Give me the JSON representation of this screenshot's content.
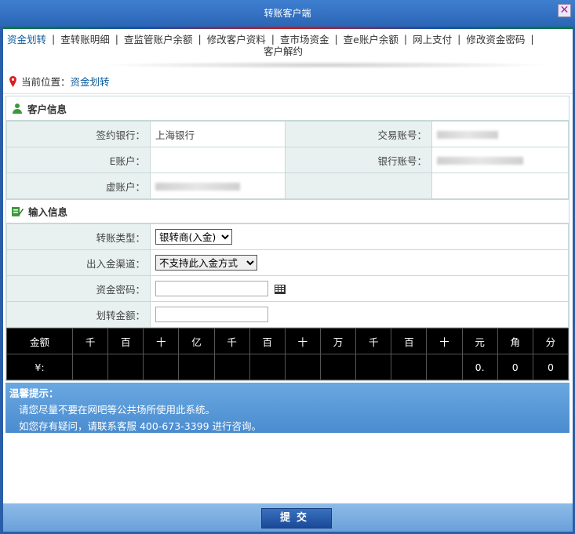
{
  "window": {
    "title": "转账客户端",
    "close": "✕"
  },
  "menu": {
    "items": [
      "资金划转",
      "查转账明细",
      "查监管账户余额",
      "修改客户资料",
      "查市场资金",
      "查e账户余额",
      "网上支付",
      "修改资金密码",
      "客户解约"
    ]
  },
  "location": {
    "label": "当前位置：",
    "link": "资金划转"
  },
  "customer_info": {
    "title": "客户信息",
    "bank_label": "签约银行：",
    "bank_value": "上海银行",
    "trade_acct_label": "交易账号：",
    "e_acct_label": "E账户：",
    "bank_acct_label": "银行账号：",
    "virtual_acct_label": "虚账户："
  },
  "input_info": {
    "title": "输入信息",
    "transfer_type_label": "转账类型：",
    "transfer_type_value": "银转商(入金)",
    "channel_label": "出入金渠道：",
    "channel_value": "不支持此入金方式",
    "password_label": "资金密码：",
    "amount_label": "划转金额："
  },
  "amount_grid": {
    "header": [
      "金额",
      "千",
      "百",
      "十",
      "亿",
      "千",
      "百",
      "十",
      "万",
      "千",
      "百",
      "十",
      "元",
      "角",
      "分"
    ],
    "row": [
      "¥:",
      "",
      "",
      "",
      "",
      "",
      "",
      "",
      "",
      "",
      "",
      "",
      "0.",
      "0",
      "0"
    ]
  },
  "tips": {
    "title": "温馨提示：",
    "line1": "请您尽量不要在网吧等公共场所使用此系统。",
    "line2": "如您存有疑问，请联系客服  400-673-3399 进行咨询。"
  },
  "submit_label": "提交",
  "colors": {
    "title_bar": "#2b65b5",
    "grid_bg": "#000000",
    "tip_bg": "#5a9ad8"
  }
}
